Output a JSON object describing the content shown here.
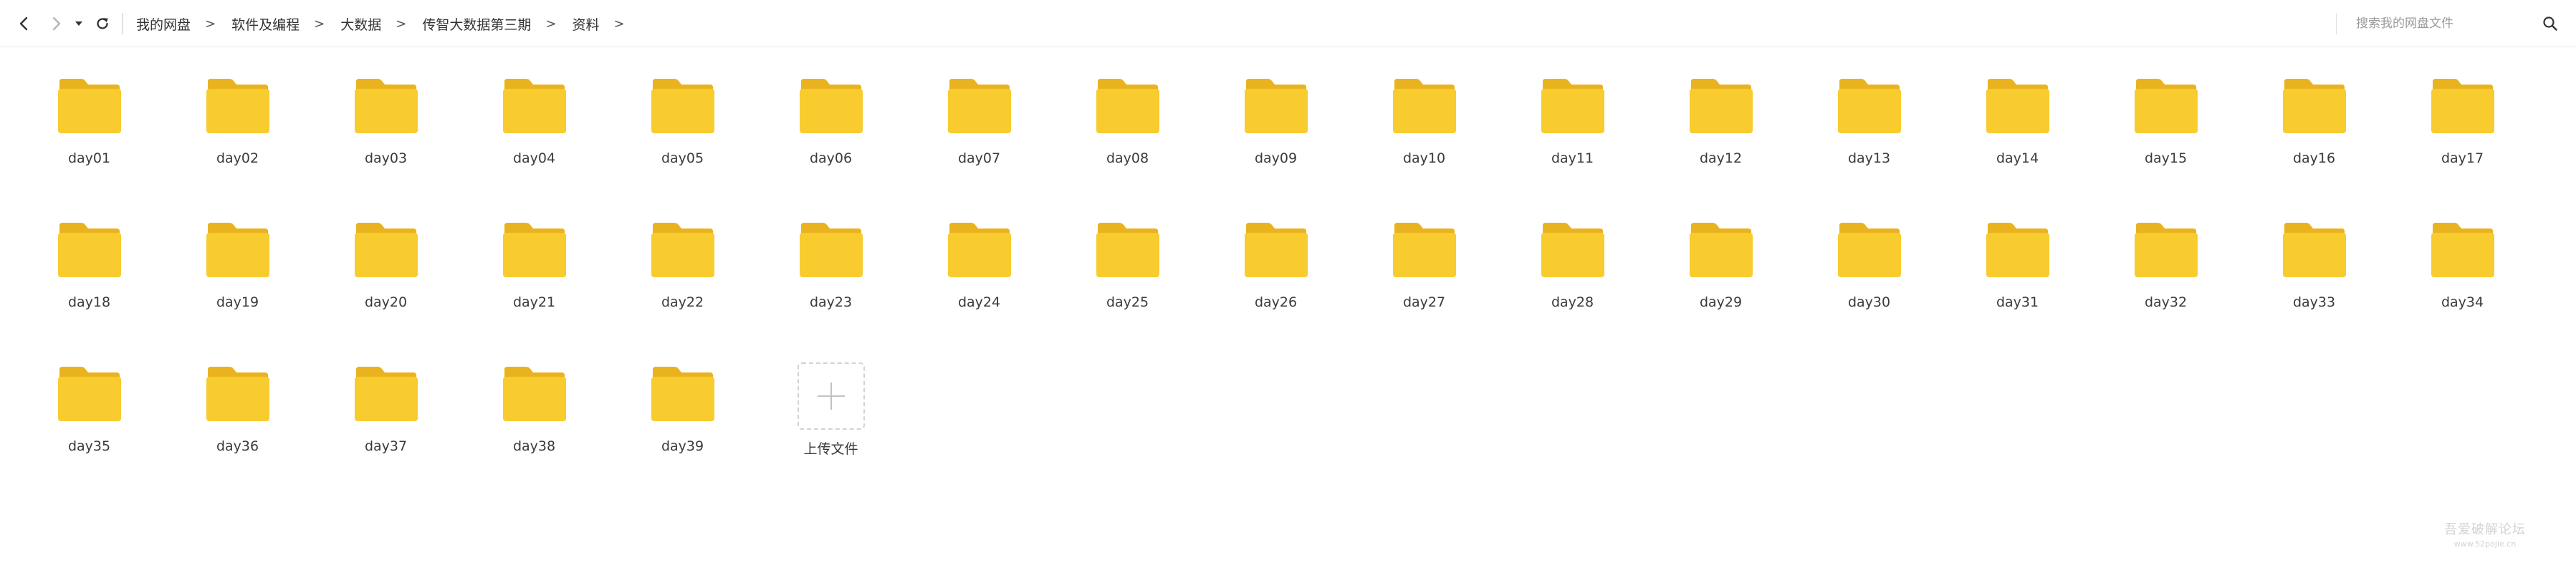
{
  "toolbar": {
    "back_icon": "chevron-left-icon",
    "forward_icon": "chevron-right-icon",
    "history_icon": "caret-down-icon",
    "refresh_icon": "refresh-icon",
    "breadcrumb": [
      {
        "label": "我的网盘"
      },
      {
        "label": "软件及编程"
      },
      {
        "label": "大数据"
      },
      {
        "label": "传智大数据第三期"
      },
      {
        "label": "资料"
      }
    ],
    "separator": ">"
  },
  "search": {
    "placeholder": "搜索我的网盘文件",
    "value": ""
  },
  "files": [
    {
      "name": "day01"
    },
    {
      "name": "day02"
    },
    {
      "name": "day03"
    },
    {
      "name": "day04"
    },
    {
      "name": "day05"
    },
    {
      "name": "day06"
    },
    {
      "name": "day07"
    },
    {
      "name": "day08"
    },
    {
      "name": "day09"
    },
    {
      "name": "day10"
    },
    {
      "name": "day11"
    },
    {
      "name": "day12"
    },
    {
      "name": "day13"
    },
    {
      "name": "day14"
    },
    {
      "name": "day15"
    },
    {
      "name": "day16"
    },
    {
      "name": "day17"
    },
    {
      "name": "day18"
    },
    {
      "name": "day19"
    },
    {
      "name": "day20"
    },
    {
      "name": "day21"
    },
    {
      "name": "day22"
    },
    {
      "name": "day23"
    },
    {
      "name": "day24"
    },
    {
      "name": "day25"
    },
    {
      "name": "day26"
    },
    {
      "name": "day27"
    },
    {
      "name": "day28"
    },
    {
      "name": "day29"
    },
    {
      "name": "day30"
    },
    {
      "name": "day31"
    },
    {
      "name": "day32"
    },
    {
      "name": "day33"
    },
    {
      "name": "day34"
    },
    {
      "name": "day35"
    },
    {
      "name": "day36"
    },
    {
      "name": "day37"
    },
    {
      "name": "day38"
    },
    {
      "name": "day39"
    }
  ],
  "upload": {
    "label": "上传文件",
    "icon": "plus-icon"
  },
  "colors": {
    "folder_body": "#F8CB2F",
    "folder_tab": "#E9B320",
    "text": "#333333",
    "border": "#E9E9E9"
  },
  "watermark": {
    "title": "吾爱破解论坛",
    "url": "www.52pojie.cn"
  }
}
